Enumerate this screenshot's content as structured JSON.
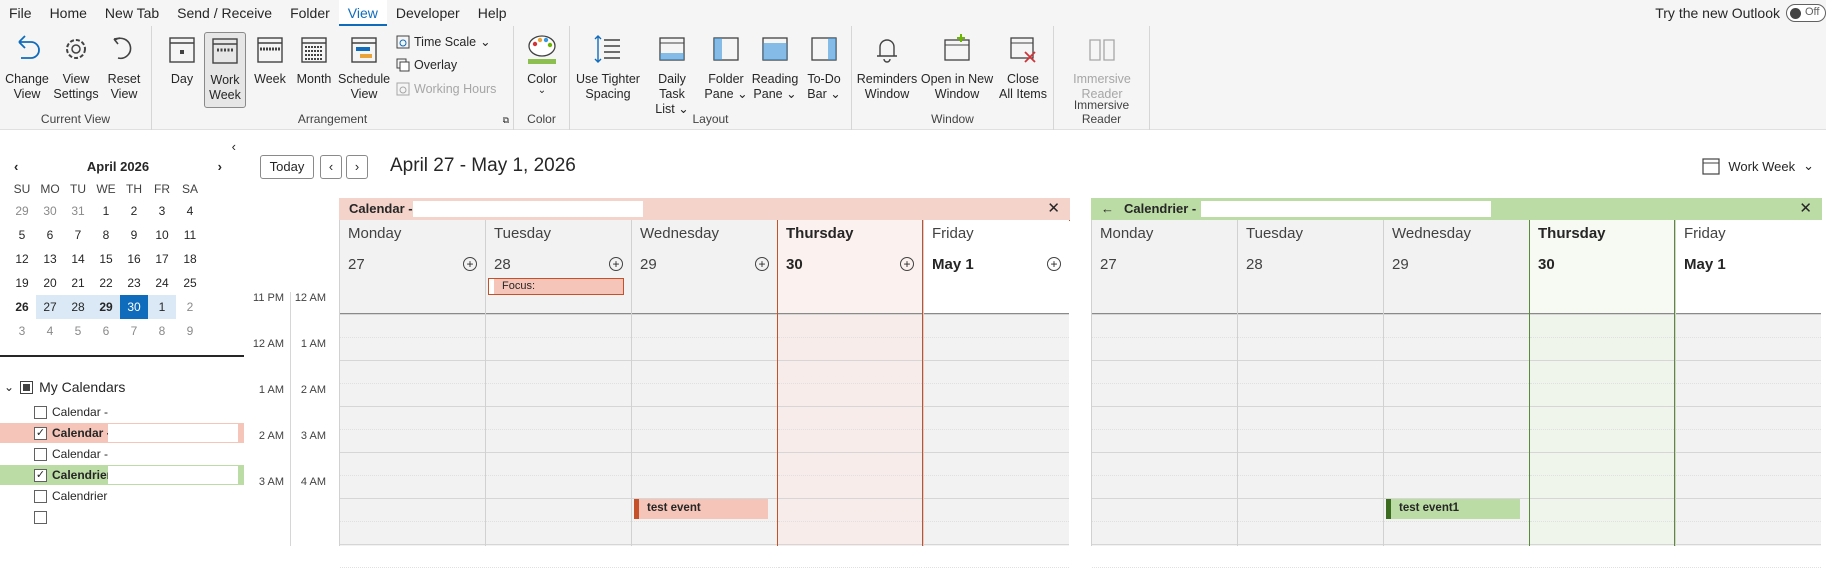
{
  "menu": {
    "items": [
      "File",
      "Home",
      "New Tab",
      "Send / Receive",
      "Folder",
      "View",
      "Developer",
      "Help"
    ],
    "active": "View",
    "try_new_outlook": "Try the new Outlook",
    "toggle_label": "Off"
  },
  "ribbon": {
    "current_view": {
      "label": "Current View",
      "change_view": "Change\nView",
      "view_settings": "View\nSettings",
      "reset_view": "Reset\nView"
    },
    "arrangement": {
      "label": "Arrangement",
      "day": "Day",
      "work_week": "Work\nWeek",
      "week": "Week",
      "month": "Month",
      "schedule_view": "Schedule\nView",
      "time_scale": "Time Scale",
      "overlay": "Overlay",
      "working_hours": "Working Hours"
    },
    "color": {
      "label": "Color",
      "color": "Color"
    },
    "layout": {
      "label": "Layout",
      "tighter_spacing": "Use Tighter\nSpacing",
      "daily_task_list": "Daily Task\nList",
      "folder_pane": "Folder\nPane",
      "reading_pane": "Reading\nPane",
      "todo_bar": "To-Do\nBar"
    },
    "window": {
      "label": "Window",
      "reminders": "Reminders\nWindow",
      "open_new": "Open in New\nWindow",
      "close_all": "Close\nAll Items"
    },
    "immersive": {
      "label": "Immersive Reader",
      "reader": "Immersive\nReader"
    }
  },
  "mini_calendar": {
    "month": "April 2026",
    "day_names": [
      "SU",
      "MO",
      "TU",
      "WE",
      "TH",
      "FR",
      "SA"
    ],
    "weeks": [
      [
        "29",
        "30",
        "31",
        "1",
        "2",
        "3",
        "4"
      ],
      [
        "5",
        "6",
        "7",
        "8",
        "9",
        "10",
        "11"
      ],
      [
        "12",
        "13",
        "14",
        "15",
        "16",
        "17",
        "18"
      ],
      [
        "19",
        "20",
        "21",
        "22",
        "23",
        "24",
        "25"
      ],
      [
        "26",
        "27",
        "28",
        "29",
        "30",
        "1",
        "2"
      ],
      [
        "3",
        "4",
        "5",
        "6",
        "7",
        "8",
        "9"
      ]
    ]
  },
  "my_calendars": {
    "title": "My Calendars",
    "items": [
      {
        "label": "Calendar -",
        "checked": false,
        "color": ""
      },
      {
        "label": "Calendar -",
        "checked": true,
        "color": "#f4c5b8"
      },
      {
        "label": "Calendar -",
        "checked": false,
        "color": ""
      },
      {
        "label": "Calendrier",
        "checked": true,
        "color": "#bcdca5"
      },
      {
        "label": "Calendrier",
        "checked": false,
        "color": ""
      },
      {
        "label": "",
        "checked": false,
        "color": ""
      }
    ]
  },
  "toolbar": {
    "today": "Today",
    "date_range": "April 27 - May 1, 2026",
    "view_mode": "Work Week"
  },
  "times": {
    "left": [
      "11 PM",
      "12 AM",
      "1 AM",
      "2 AM",
      "3 AM"
    ],
    "right": [
      "12 AM",
      "1 AM",
      "2 AM",
      "3 AM",
      "4 AM"
    ]
  },
  "panes": [
    {
      "title": "Calendar -",
      "header_color": "#f4d3ca",
      "accent": "#c4512a",
      "days": [
        {
          "name": "Monday",
          "num": "27"
        },
        {
          "name": "Tuesday",
          "num": "28"
        },
        {
          "name": "Wednesday",
          "num": "29"
        },
        {
          "name": "Thursday",
          "num": "30"
        },
        {
          "name": "Friday",
          "num": "May 1"
        }
      ],
      "all_day_event": "Focus:",
      "event": "test event"
    },
    {
      "title": "Calendrier -",
      "header_color": "#bcdca5",
      "accent": "#5b8a3a",
      "days": [
        {
          "name": "Monday",
          "num": "27"
        },
        {
          "name": "Tuesday",
          "num": "28"
        },
        {
          "name": "Wednesday",
          "num": "29"
        },
        {
          "name": "Thursday",
          "num": "30"
        },
        {
          "name": "Friday",
          "num": "May 1"
        }
      ],
      "event": "test event1"
    }
  ]
}
